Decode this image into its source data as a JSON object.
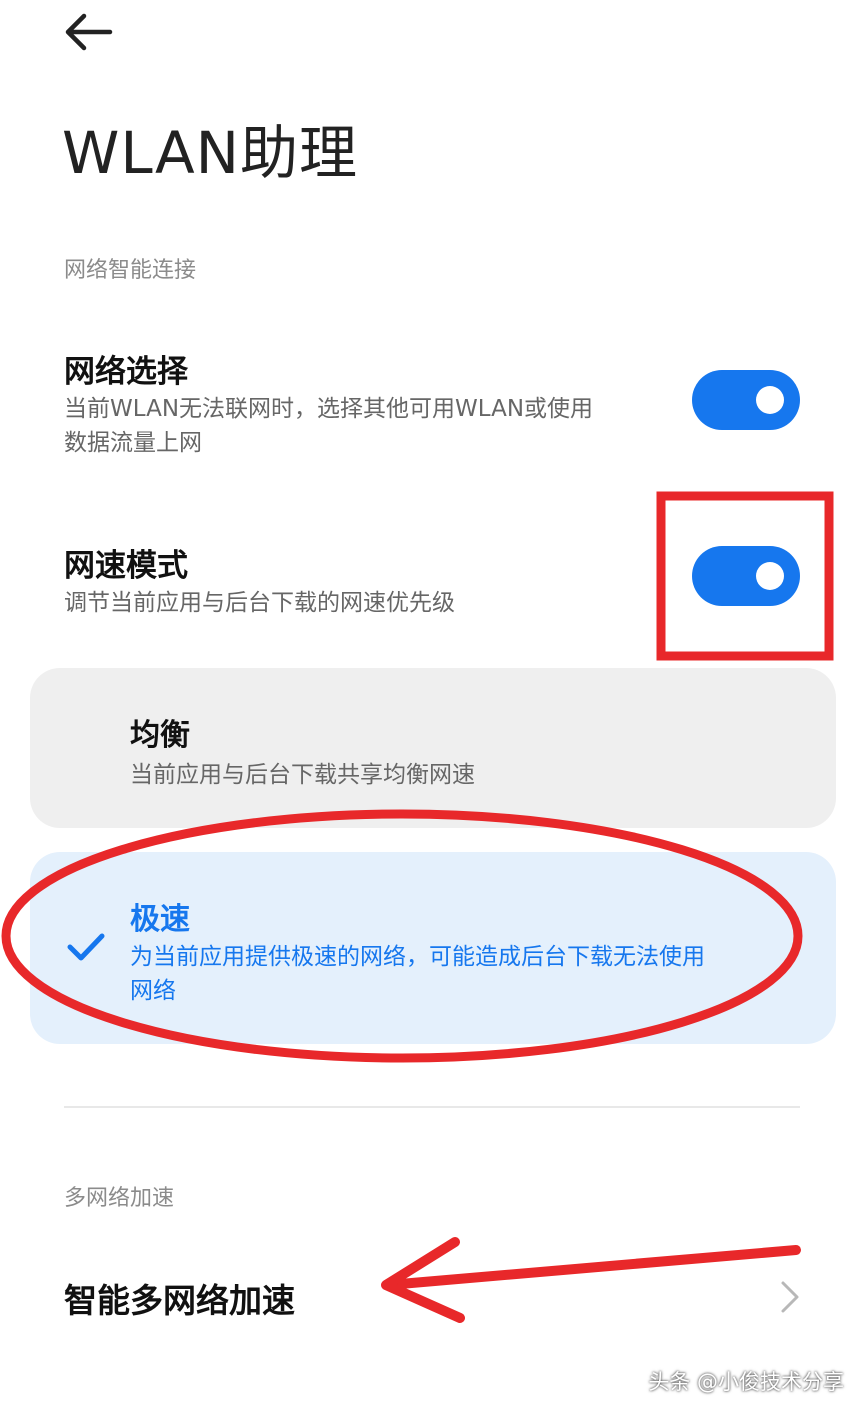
{
  "header": {
    "back_icon": "arrow-left-icon",
    "title": "WLAN助理"
  },
  "section_smart_connect": {
    "label": "网络智能连接",
    "network_selection": {
      "title": "网络选择",
      "desc_line1": "当前WLAN无法联网时，选择其他可用WLAN或使用",
      "desc_line2": "数据流量上网",
      "toggle_on": true
    },
    "speed_mode": {
      "title": "网速模式",
      "desc": "调节当前应用与后台下载的网速优先级",
      "toggle_on": true,
      "options": [
        {
          "title": "均衡",
          "desc": "当前应用与后台下载共享均衡网速",
          "selected": false
        },
        {
          "title": "极速",
          "desc_line1": "为当前应用提供极速的网络，可能造成后台下载无法使用",
          "desc_line2": "网络",
          "selected": true,
          "check_icon": "check-icon"
        }
      ]
    }
  },
  "section_multi_network": {
    "label": "多网络加速",
    "item": {
      "title": "智能多网络加速",
      "chevron_icon": "chevron-right-icon"
    }
  },
  "watermark": "头条 @小俊技术分享",
  "colors": {
    "accent": "#1677ee",
    "selected_bg": "#e4f0fc",
    "annotation_red": "#e8282a"
  }
}
